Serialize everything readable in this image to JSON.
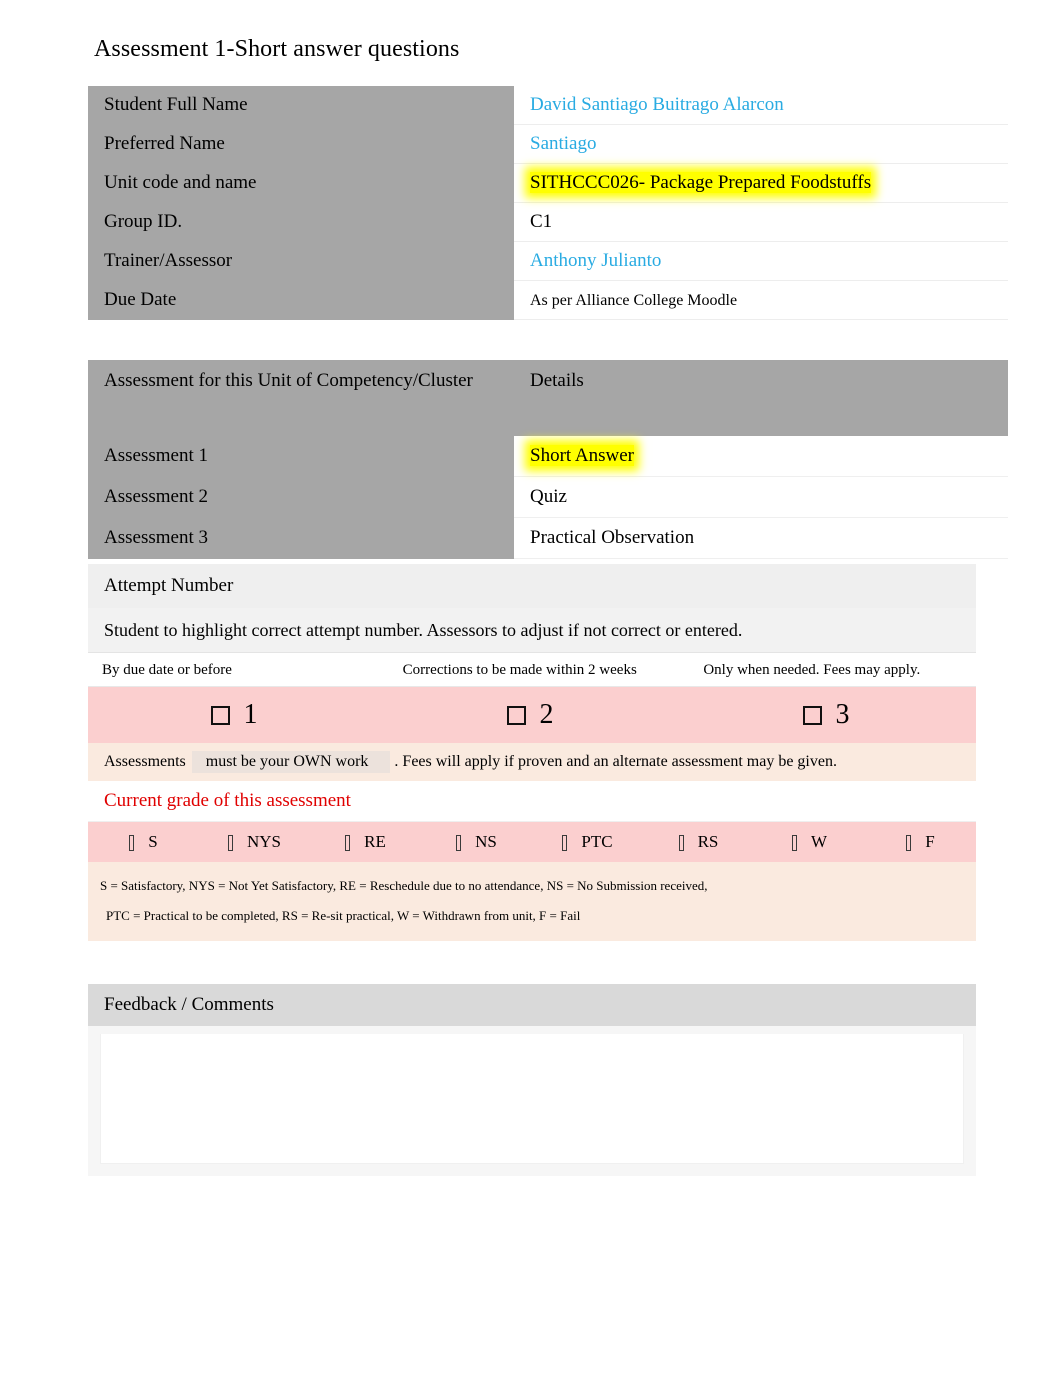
{
  "document": {
    "title": "Assessment 1-Short answer questions"
  },
  "student_table": {
    "rows": [
      {
        "label": "Student Full Name",
        "value": "David Santiago Buitrago Alarcon",
        "style": "cyan"
      },
      {
        "label": "Preferred Name",
        "value": "Santiago",
        "style": "cyan"
      },
      {
        "label": "Unit code and name",
        "value": "SITHCCC026- Package Prepared Foodstuffs",
        "style": "highlight-yellow"
      },
      {
        "label": "Group ID.",
        "value": "C1",
        "style": "plain"
      },
      {
        "label": "Trainer/Assessor",
        "value": "Anthony Julianto",
        "style": "cyan"
      },
      {
        "label": "Due Date",
        "value": "As per Alliance College Moodle",
        "style": "plain-small"
      }
    ]
  },
  "assessment_table": {
    "header": {
      "left": "Assessment for this Unit of Competency/Cluster",
      "right": "Details"
    },
    "rows": [
      {
        "label": "Assessment 1",
        "value": "Short Answer",
        "style": "highlight-yellow"
      },
      {
        "label": "Assessment 2",
        "value": "Quiz",
        "style": "plain"
      },
      {
        "label": "Assessment 3",
        "value": "Practical Observation",
        "style": "plain"
      }
    ]
  },
  "attempt": {
    "heading": "Attempt Number",
    "instruction": "Student to highlight correct attempt number. Assessors to adjust if not correct or entered.",
    "columns": [
      "By due date or before",
      "Corrections to be made within 2 weeks",
      "Only when needed. Fees may apply."
    ],
    "numbers": [
      {
        "label": "1",
        "selected": true
      },
      {
        "label": "2",
        "selected": false
      },
      {
        "label": "3",
        "selected": false
      }
    ],
    "own_work_prefix": "Assessments",
    "own_work_emphasis": "must be your OWN work",
    "own_work_suffix": ". Fees will apply if proven and an alternate assessment may be given."
  },
  "grade": {
    "title": "Current grade of this assessment",
    "title_color": "#E00000",
    "options": [
      "S",
      "NYS",
      "RE",
      "NS",
      "PTC",
      "RS",
      "W",
      "F"
    ],
    "legend_line1": "S = Satisfactory, NYS = Not Yet Satisfactory, RE = Reschedule due to no attendance, NS = No Submission received,",
    "legend_line2": "PTC = Practical to be completed, RS = Re-sit practical, W = Withdrawn from unit, F = Fail"
  },
  "feedback": {
    "heading": "Feedback / Comments",
    "body": ""
  },
  "colors": {
    "label_gray": "#A6A6A6",
    "highlight_yellow": "#FFFF00",
    "link_cyan": "#29ABE2",
    "pink": "#FBCFCF",
    "cream": "#FAEADF",
    "feedback_gray": "#D9D9D9",
    "red": "#E00000"
  }
}
